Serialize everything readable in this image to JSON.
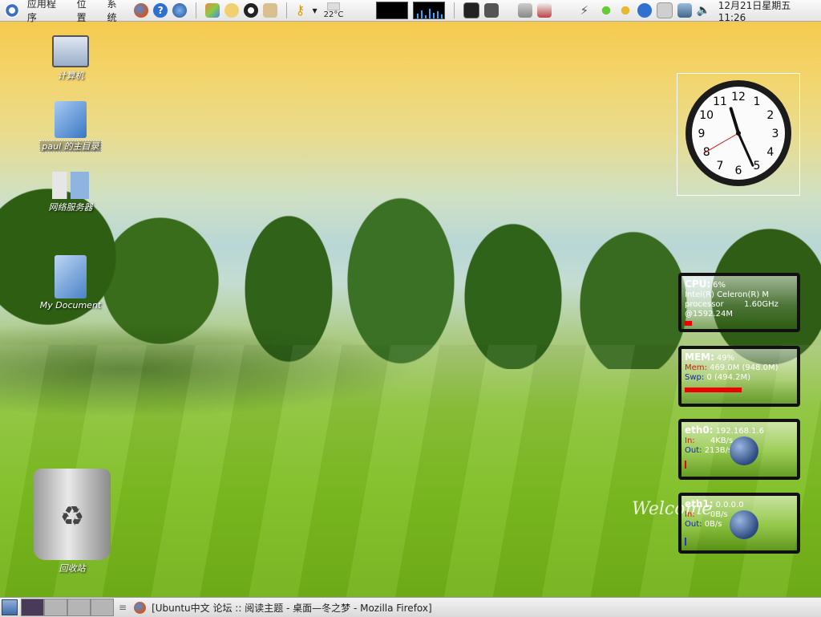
{
  "top_panel": {
    "menus": [
      "应用程序",
      "位置",
      "系统"
    ],
    "temperature": "22°C",
    "datetime": "12月21日星期五 11:26"
  },
  "desktop": {
    "icons": [
      {
        "label": "计算机"
      },
      {
        "label": "paul 的主目录"
      },
      {
        "label": "网络服务器"
      },
      {
        "label": "My Document"
      },
      {
        "label": "回收站"
      }
    ],
    "watermark": "Welcome"
  },
  "clock_widget": {
    "numbers": [
      "12",
      "1",
      "2",
      "3",
      "4",
      "5",
      "6",
      "7",
      "8",
      "9",
      "10",
      "11"
    ],
    "time": {
      "hour": 11,
      "minute": 26,
      "second": 40
    }
  },
  "monitors": {
    "cpu": {
      "title": "CPU:",
      "value": "6%",
      "line1": "Intel(R) Celeron(R) M",
      "line2": "processor        1.60GHz",
      "line3": "@1592.24M",
      "usage_fraction": 0.06
    },
    "mem": {
      "title": "MEM:",
      "value": "49%",
      "mem_label": "Mem:",
      "mem_value": "469.0M (948.0M)",
      "swp_label": "Swp:",
      "swp_value": "0 (494.2M)",
      "usage_fraction": 0.49
    },
    "eth0": {
      "title": "eth0:",
      "ip": "192.168.1.6",
      "in_label": "In:",
      "in_value": "4KB/s",
      "out_label": "Out:",
      "out_value": "213B/s"
    },
    "eth1": {
      "title": "eth1:",
      "ip": "0.0.0.0",
      "in_label": "In:",
      "in_value": "0B/s",
      "out_label": "Out:",
      "out_value": "0B/s"
    }
  },
  "bottom_panel": {
    "workspaces": 4,
    "active_workspace": 1,
    "task_title": "[Ubuntu中文 论坛 :: 阅读主题 - 桌面—冬之梦 - Mozilla Firefox]"
  },
  "colors": {
    "accent": "#e00000",
    "panel": "#e8e8e8"
  }
}
